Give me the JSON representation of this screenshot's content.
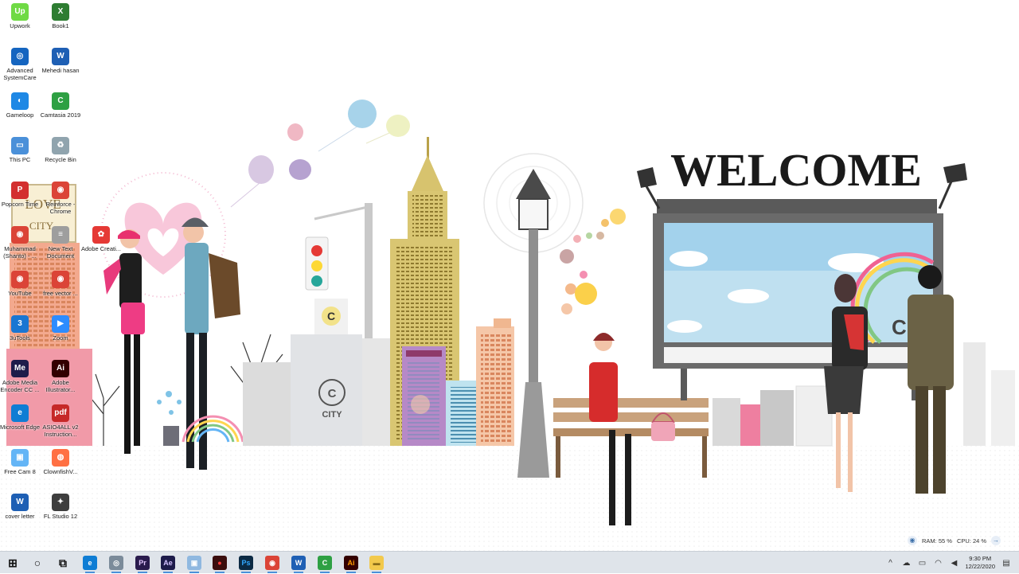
{
  "wallpaper": {
    "welcome_text": "WELCOME",
    "city_label": "CITY",
    "c_letter": "C",
    "billboard_city": "CIT",
    "love_text": "LOVE",
    "love_city": "CITY"
  },
  "desktop_icons": [
    {
      "label": "Upwork",
      "icon": "upwork-icon",
      "color": "#6fda44",
      "glyph": "Up"
    },
    {
      "label": "Book1",
      "icon": "excel-file-icon",
      "color": "#2e7d32",
      "glyph": "X"
    },
    {
      "label": "Advanced SystemCare",
      "icon": "systemcare-icon",
      "color": "#1565c0",
      "glyph": "◎"
    },
    {
      "label": "Mehedi hasan",
      "icon": "word-file-icon",
      "color": "#1e5fb4",
      "glyph": "W"
    },
    {
      "label": "Gameloop",
      "icon": "gameloop-icon",
      "color": "#1e88e5",
      "glyph": "◐"
    },
    {
      "label": "Camtasia 2019",
      "icon": "camtasia-icon",
      "color": "#2ea043",
      "glyph": "C"
    },
    {
      "label": "This PC",
      "icon": "computer-icon",
      "color": "#4a90d9",
      "glyph": "▭"
    },
    {
      "label": "Recycle Bin",
      "icon": "recycle-bin-icon",
      "color": "#90a4ae",
      "glyph": "♻"
    },
    {
      "label": "Popcorn Time",
      "icon": "popcorn-icon",
      "color": "#d32f2f",
      "glyph": "P"
    },
    {
      "label": "Reinforce - Chrome",
      "icon": "chrome-icon",
      "color": "#db4437",
      "glyph": "◉"
    },
    {
      "label": "Muhammad (Shanto) - ...",
      "icon": "chrome-icon",
      "color": "#db4437",
      "glyph": "◉"
    },
    {
      "label": "New Text Document",
      "icon": "text-document-icon",
      "color": "#9e9e9e",
      "glyph": "≡"
    },
    {
      "label": "Adobe Creati...",
      "icon": "adobe-cc-icon",
      "color": "#e53935",
      "glyph": "✿"
    },
    {
      "label": "YouTube",
      "icon": "chrome-icon",
      "color": "#db4437",
      "glyph": "◉"
    },
    {
      "label": "free vector ...",
      "icon": "chrome-icon",
      "color": "#db4437",
      "glyph": "◉"
    },
    {
      "label": "3uTools",
      "icon": "3utools-icon",
      "color": "#1976d2",
      "glyph": "3"
    },
    {
      "label": "Zoom",
      "icon": "zoom-icon",
      "color": "#2d8cff",
      "glyph": "▶"
    },
    {
      "label": "Adobe Media Encoder CC ...",
      "icon": "media-encoder-icon",
      "color": "#1f1c4a",
      "glyph": "Me"
    },
    {
      "label": "Adobe Illustrator...",
      "icon": "illustrator-icon",
      "color": "#330000",
      "glyph": "Ai"
    },
    {
      "label": "Microsoft Edge",
      "icon": "edge-icon",
      "color": "#0f7dd4",
      "glyph": "e"
    },
    {
      "label": "ASIO4ALL v2 Instruction...",
      "icon": "pdf-icon",
      "color": "#c62828",
      "glyph": "pdf"
    },
    {
      "label": "Free Cam 8",
      "icon": "freecam-icon",
      "color": "#64b5f6",
      "glyph": "▣"
    },
    {
      "label": "ClownfishV...",
      "icon": "clownfish-icon",
      "color": "#ff7043",
      "glyph": "◍"
    },
    {
      "label": "cover letter",
      "icon": "word-file-icon",
      "color": "#1e5fb4",
      "glyph": "W"
    },
    {
      "label": "FL Studio 12",
      "icon": "fl-studio-icon",
      "color": "#3e3e3e",
      "glyph": "✦"
    }
  ],
  "widget": {
    "ram": "RAM: 55 %",
    "cpu": "CPU: 24 %"
  },
  "taskbar": {
    "apps": [
      {
        "icon": "start-icon",
        "glyph": "⊞",
        "color": "transparent",
        "fg": "#111"
      },
      {
        "icon": "search-icon",
        "glyph": "○",
        "color": "transparent",
        "fg": "#111"
      },
      {
        "icon": "task-view-icon",
        "glyph": "⧉",
        "color": "transparent",
        "fg": "#111"
      },
      {
        "icon": "edge-icon",
        "glyph": "e",
        "color": "#0f7dd4",
        "fg": "#fff"
      },
      {
        "icon": "systemcare-icon",
        "glyph": "◎",
        "color": "#7b8b9a",
        "fg": "#fff"
      },
      {
        "icon": "premiere-icon",
        "glyph": "Pr",
        "color": "#2a1b4d",
        "fg": "#e3c6ff"
      },
      {
        "icon": "after-effects-icon",
        "glyph": "Ae",
        "color": "#1d1b4a",
        "fg": "#d4c2ff"
      },
      {
        "icon": "freecam-icon",
        "glyph": "▣",
        "color": "#8fb8e0",
        "fg": "#fff"
      },
      {
        "icon": "recorder-icon",
        "glyph": "●",
        "color": "#3a0d0d",
        "fg": "#ff3a3a"
      },
      {
        "icon": "photoshop-icon",
        "glyph": "Ps",
        "color": "#0b2a44",
        "fg": "#31a8ff"
      },
      {
        "icon": "chrome-icon",
        "glyph": "◉",
        "color": "#db4437",
        "fg": "#fff"
      },
      {
        "icon": "word-icon",
        "glyph": "W",
        "color": "#1e5fb4",
        "fg": "#fff"
      },
      {
        "icon": "camtasia-icon",
        "glyph": "C",
        "color": "#2ea043",
        "fg": "#fff"
      },
      {
        "icon": "illustrator-icon",
        "glyph": "Ai",
        "color": "#330000",
        "fg": "#ff9a00"
      },
      {
        "icon": "file-explorer-icon",
        "glyph": "▬",
        "color": "#f2c94c",
        "fg": "#8a6d1a"
      }
    ],
    "clock_time": "9:30 PM",
    "clock_date": "12/22/2020"
  }
}
